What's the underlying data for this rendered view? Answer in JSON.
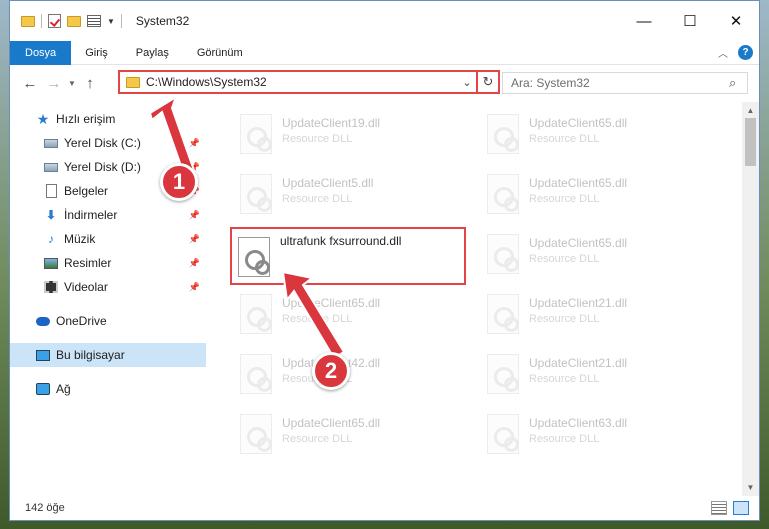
{
  "window": {
    "title": "System32"
  },
  "ribbon": {
    "tabs": [
      "Dosya",
      "Giriş",
      "Paylaş",
      "Görünüm"
    ]
  },
  "nav": {
    "address": "C:\\Windows\\System32",
    "search_placeholder": "Ara: System32"
  },
  "sidebar": {
    "quick_access": "Hızlı erişim",
    "items": [
      {
        "label": "Yerel Disk (C:)",
        "icon": "drive-icon"
      },
      {
        "label": "Yerel Disk (D:)",
        "icon": "drive-icon"
      },
      {
        "label": "Belgeler",
        "icon": "documents-icon"
      },
      {
        "label": "İndirmeler",
        "icon": "downloads-icon"
      },
      {
        "label": "Müzik",
        "icon": "music-icon"
      },
      {
        "label": "Resimler",
        "icon": "pictures-icon"
      },
      {
        "label": "Videolar",
        "icon": "videos-icon"
      }
    ],
    "onedrive": "OneDrive",
    "this_pc": "Bu bilgisayar",
    "network": "Ağ"
  },
  "files": {
    "highlighted": {
      "name": "ultrafunk fxsurround.dll"
    },
    "left_column": [
      {
        "name": "UpdateClient19.dll",
        "type": "Resource DLL"
      },
      {
        "name": "UpdateClient5.dll",
        "type": "Resource DLL"
      },
      {
        "name": "UpdateClient65.dll",
        "type": "Resource DLL"
      },
      {
        "name": "UpdateClient42.dll",
        "type": "Resource DLL"
      },
      {
        "name": "UpdateClient65.dll",
        "type": "Resource DLL"
      }
    ],
    "right_column": [
      {
        "name": "UpdateClient65.dll",
        "type": "Resource DLL"
      },
      {
        "name": "UpdateClient65.dll",
        "type": "Resource DLL"
      },
      {
        "name": "UpdateClient65.dll",
        "type": "Resource DLL"
      },
      {
        "name": "UpdateClient21.dll",
        "type": "Resource DLL"
      },
      {
        "name": "UpdateClient21.dll",
        "type": "Resource DLL"
      },
      {
        "name": "UpdateClient63.dll",
        "type": "Resource DLL"
      }
    ]
  },
  "status": {
    "count": "142 öğe"
  },
  "markers": {
    "step1": "1",
    "step2": "2"
  },
  "colors": {
    "accent": "#1979ca",
    "highlight": "#e14545",
    "marker": "#d9363e"
  }
}
